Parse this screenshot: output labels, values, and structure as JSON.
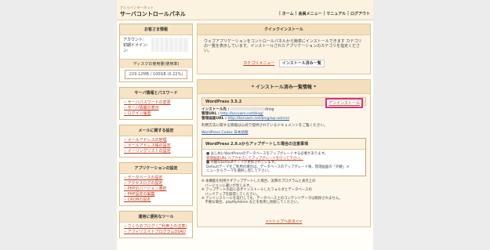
{
  "header": {
    "brand_subtitle": "さくらインターネット",
    "brand_title": "サーバコントロールパネル",
    "nav": [
      "ホーム",
      "会員メニュー",
      "マニュアル",
      "ログアウト"
    ],
    "sep": "|"
  },
  "account": {
    "title": "お客さま情報",
    "labels": [
      "アカウント:",
      "初期ドメイン:",
      "ン:"
    ],
    "disk_title": "ディスクの使用量(使用率)",
    "disk_value": "229.12MB / 100GB (0.22%)"
  },
  "server_menu": {
    "title": "サーバ情報とパスワード",
    "items": [
      "サーバパスワードの変更",
      "サーバ情報の表示",
      "ログイン履歴"
    ]
  },
  "mail_menu": {
    "title": "メールに関する設定",
    "items": [
      "メールアドレスの管理",
      "メールアドレス帳の設定",
      "メーリングリストの設定"
    ]
  },
  "app_menu": {
    "title": "アプリケーションの設定",
    "items": [
      "データベースの設定",
      "アクセスログの設定",
      "PHPのバージョン選択",
      "PHP設定の編集",
      "CRONの設定"
    ]
  },
  "util_menu": {
    "title": "運用に便利なツール",
    "items": [
      "さくらのブログ (ご利用上の注意)",
      "アフィリエイトプログラムDSAD"
    ]
  },
  "quick_install": {
    "title": "クイックインストール",
    "desc": "ウェブアプリケーションをコントロールパネルから簡単にインストールできます カテゴリの一覧を表示しています。インストールされたアプリケーションのカテゴリを指定ください。",
    "tab_category": "カテゴリメニュー",
    "tab_installed": "インストール済み一覧"
  },
  "installed": {
    "title": "* インストール済み一覧情報 *",
    "app_name": "WordPress 3.5.2",
    "uninstall_label": "アンインストール",
    "install_path_label": "インストール先 :",
    "install_path_suffix": "/blog",
    "site_url_label": "管理URL :",
    "site_url": "http://koruwm.net/blog/",
    "admin_url_label": "管理画面URL :",
    "admin_url": "http://koruwm.net/blog/wp-admin/",
    "note": "利用方法に関する情報は公式で提供されているドキュメントをご覧ください。",
    "doc_link": "WordPress Codex 日本語版",
    "notice_title": "WordPress 2.9.xからアップデートした場合の注意事項",
    "notice_lines": [
      "■ はじめにWordPressのデータベースをアップグレードする必要があります。",
      "管理画面URL へアクセスしてアップグレードを行って下さい。",
      "■ 外観のDefaultテーマが更新されています。",
      "Defaultテーマをご利用の場合は、データベースのアップグレード後、管理画面の「外観」メ",
      "ニューからテーマを選択し直して下さい。"
    ],
    "bullets": [
      "※ 本機能を利用せずアップデートした場合、実際のプログラムと表示上の",
      "　バージョンに違いが生じます。",
      "※ アップデートの前に必ずインストールしたフォルダとデータベースの",
      "　バックアップを取得してください。",
      "※ アンインストールを実行しても、データベース上のコンテンツデータは削除されません。",
      "　不要な場合、phpMyAdmin などを利用し削除してください。"
    ],
    "to_top": ">>トップへ戻る<<"
  }
}
